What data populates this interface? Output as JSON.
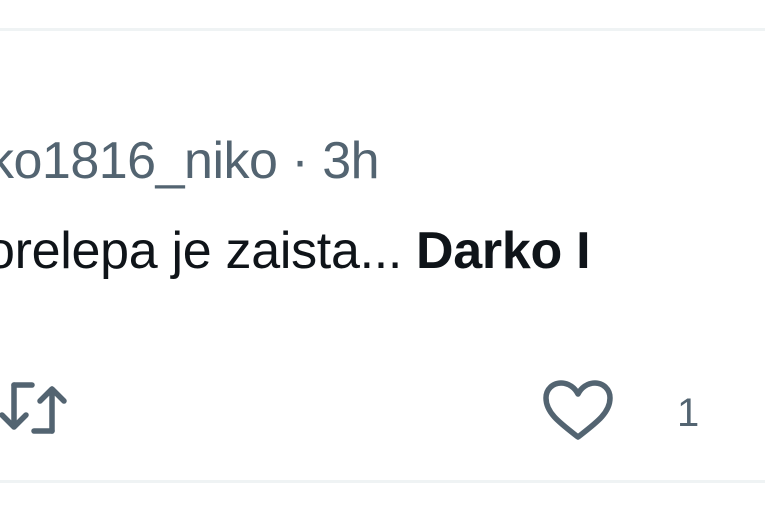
{
  "post": {
    "username": "ko1816_niko",
    "separator": "·",
    "time": "3h",
    "text": "orelepa je zaista...",
    "mention": "Darko I",
    "likes": "1"
  },
  "icons": {
    "repost": "repost-icon",
    "like": "heart-icon"
  },
  "colors": {
    "text_primary": "#0f1419",
    "text_secondary": "#536471",
    "divider": "#eff3f4"
  }
}
